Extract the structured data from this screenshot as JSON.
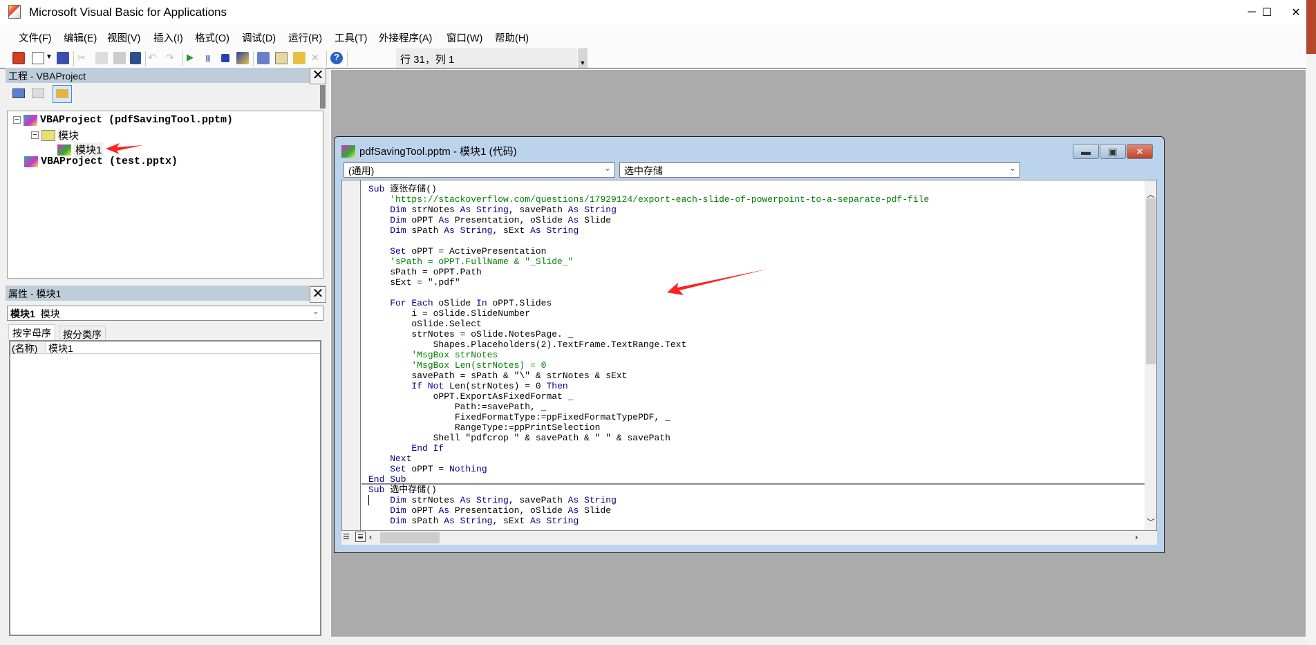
{
  "app": {
    "title": "Microsoft Visual Basic for Applications"
  },
  "menu": [
    "文件(F)",
    "编辑(E)",
    "视图(V)",
    "插入(I)",
    "格式(O)",
    "调试(D)",
    "运行(R)",
    "工具(T)",
    "外接程序(A)",
    "窗口(W)",
    "帮助(H)"
  ],
  "toolbar": {
    "status": "行 31，列 1",
    "icons": [
      "powerpoint-icon",
      "userform-icon",
      "dropdown-icon",
      "save-icon",
      "cut-icon",
      "copy-icon",
      "paste-icon",
      "find-icon",
      "undo-icon",
      "redo-icon",
      "run-icon",
      "pause-icon",
      "reset-icon",
      "design-mode-icon",
      "project-explorer-icon",
      "properties-icon",
      "object-browser-icon",
      "toolbox-icon",
      "help-icon"
    ]
  },
  "project": {
    "title": "工程 - VBAProject",
    "tree": [
      "VBAProject (pdfSavingTool.pptm)",
      "模块",
      "模块1",
      "VBAProject (test.pptx)"
    ]
  },
  "properties": {
    "title": "属性 - 模块1",
    "object_name": "模块1",
    "object_type": "模块",
    "tabs": [
      "按字母序",
      "按分类序"
    ],
    "rows": [
      {
        "name": "(名称)",
        "value": "模块1"
      }
    ]
  },
  "code_window": {
    "title": "pdfSavingTool.pptm - 模块1 (代码)",
    "object_dropdown": "(通用)",
    "procedure_dropdown": "选中存储",
    "colors": {
      "keyword": "#00008b",
      "comment": "#008000"
    },
    "lines": [
      [
        [
          "Sub ",
          "kw"
        ],
        [
          "逐张存储()",
          "tx"
        ]
      ],
      [
        [
          "    'https://stackoverflow.com/questions/17929124/export-each-slide-of-powerpoint-to-a-separate-pdf-file",
          "cm"
        ]
      ],
      [
        [
          "    Dim ",
          "kw"
        ],
        [
          "strNotes ",
          "tx"
        ],
        [
          "As String",
          "kw"
        ],
        [
          ", savePath ",
          "tx"
        ],
        [
          "As String",
          "kw"
        ]
      ],
      [
        [
          "    Dim ",
          "kw"
        ],
        [
          "oPPT ",
          "tx"
        ],
        [
          "As ",
          "kw"
        ],
        [
          "Presentation, oSlide ",
          "tx"
        ],
        [
          "As ",
          "kw"
        ],
        [
          "Slide",
          "tx"
        ]
      ],
      [
        [
          "    Dim ",
          "kw"
        ],
        [
          "sPath ",
          "tx"
        ],
        [
          "As String",
          "kw"
        ],
        [
          ", sExt ",
          "tx"
        ],
        [
          "As String",
          "kw"
        ]
      ],
      [],
      [
        [
          "    Set ",
          "kw"
        ],
        [
          "oPPT = ActivePresentation",
          "tx"
        ]
      ],
      [
        [
          "    'sPath = oPPT.FullName & \"_Slide_\"",
          "cm"
        ]
      ],
      [
        [
          "    sPath = oPPT.Path",
          "tx"
        ]
      ],
      [
        [
          "    sExt = \".pdf\"",
          "tx"
        ]
      ],
      [],
      [
        [
          "    For Each ",
          "kw"
        ],
        [
          "oSlide ",
          "tx"
        ],
        [
          "In ",
          "kw"
        ],
        [
          "oPPT.Slides",
          "tx"
        ]
      ],
      [
        [
          "        i = oSlide.SlideNumber",
          "tx"
        ]
      ],
      [
        [
          "        oSlide.Select",
          "tx"
        ]
      ],
      [
        [
          "        strNotes = oSlide.NotesPage. _",
          "tx"
        ]
      ],
      [
        [
          "            Shapes.Placeholders(2).TextFrame.TextRange.Text",
          "tx"
        ]
      ],
      [
        [
          "        'MsgBox strNotes",
          "cm"
        ]
      ],
      [
        [
          "        'MsgBox Len(strNotes) = 0",
          "cm"
        ]
      ],
      [
        [
          "        savePath = sPath & \"\\\" & strNotes & sExt",
          "tx"
        ]
      ],
      [
        [
          "        If Not ",
          "kw"
        ],
        [
          "Len(strNotes) = 0 ",
          "tx"
        ],
        [
          "Then",
          "kw"
        ]
      ],
      [
        [
          "            oPPT.ExportAsFixedFormat _",
          "tx"
        ]
      ],
      [
        [
          "                Path:=savePath, _",
          "tx"
        ]
      ],
      [
        [
          "                FixedFormatType:=ppFixedFormatTypePDF, _",
          "tx"
        ]
      ],
      [
        [
          "                RangeType:=ppPrintSelection",
          "tx"
        ]
      ],
      [
        [
          "            Shell \"pdfcrop \" & savePath & \" \" & savePath",
          "tx"
        ]
      ],
      [
        [
          "        End If",
          "kw"
        ]
      ],
      [
        [
          "    Next",
          "kw"
        ]
      ],
      [
        [
          "    Set ",
          "kw"
        ],
        [
          "oPPT = ",
          "tx"
        ],
        [
          "Nothing",
          "kw"
        ]
      ],
      [
        [
          "End Sub",
          "kw"
        ]
      ],
      [
        [
          "Sub ",
          "kw"
        ],
        [
          "选中存储()",
          "tx"
        ]
      ],
      [
        [
          "    Dim ",
          "kw"
        ],
        [
          "strNotes ",
          "tx"
        ],
        [
          "As String",
          "kw"
        ],
        [
          ", savePath ",
          "tx"
        ],
        [
          "As String",
          "kw"
        ]
      ],
      [
        [
          "    Dim ",
          "kw"
        ],
        [
          "oPPT ",
          "tx"
        ],
        [
          "As ",
          "kw"
        ],
        [
          "Presentation, oSlide ",
          "tx"
        ],
        [
          "As ",
          "kw"
        ],
        [
          "Slide",
          "tx"
        ]
      ],
      [
        [
          "    Dim ",
          "kw"
        ],
        [
          "sPath ",
          "tx"
        ],
        [
          "As String",
          "kw"
        ],
        [
          ", sExt ",
          "tx"
        ],
        [
          "As String",
          "kw"
        ]
      ]
    ]
  }
}
